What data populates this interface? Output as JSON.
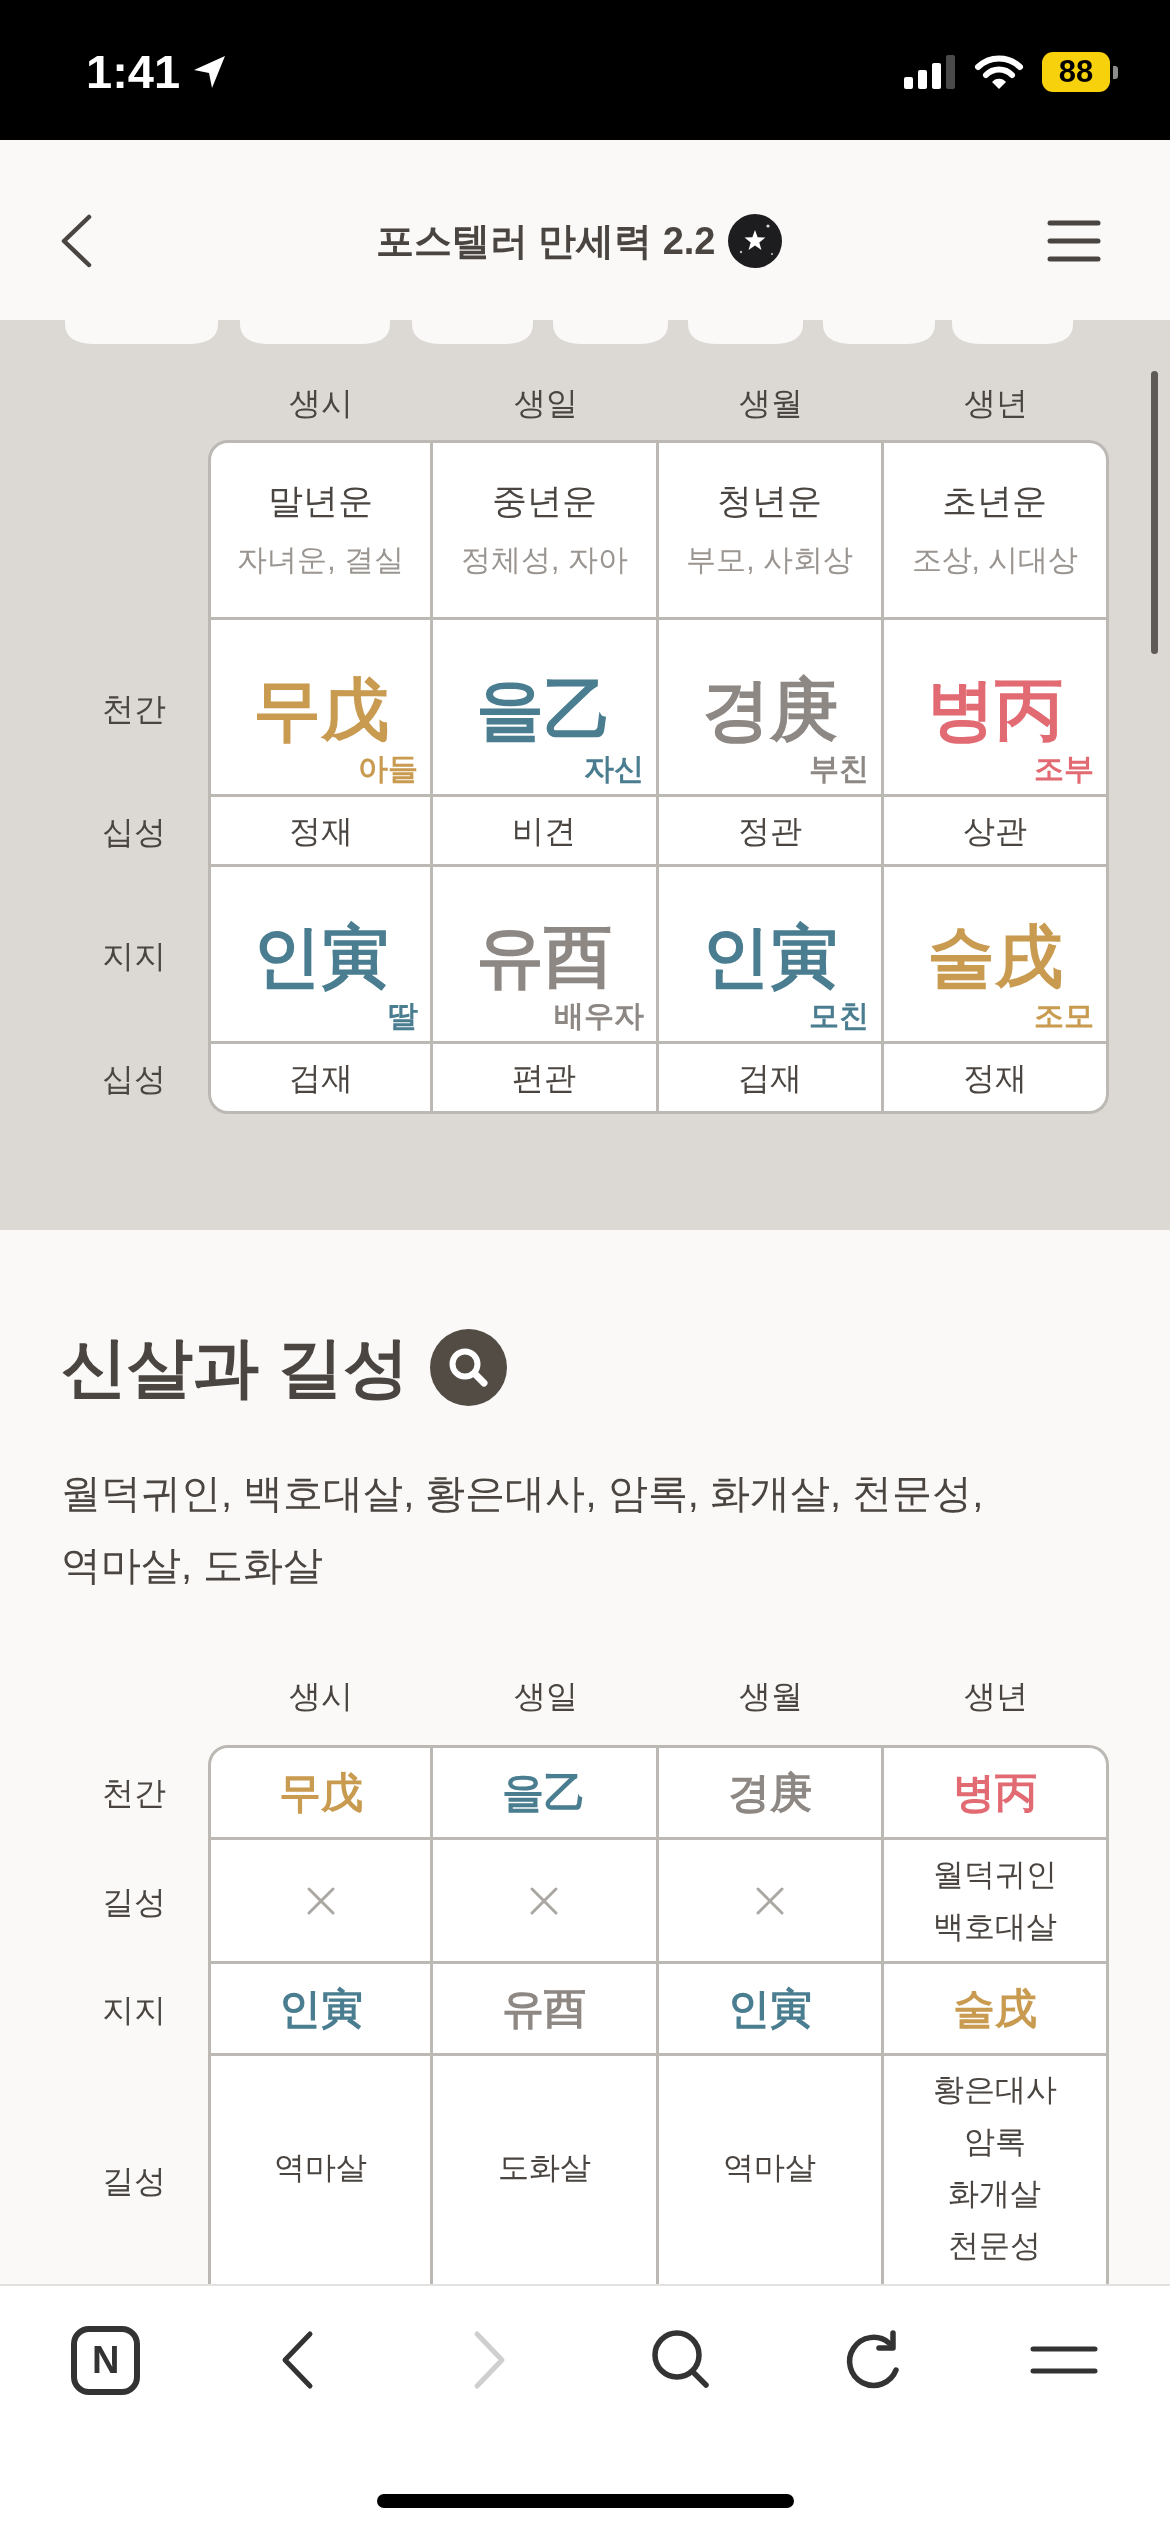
{
  "status_bar": {
    "time": "1:41",
    "battery": "88"
  },
  "header": {
    "title": "포스텔러 만세력 2.2"
  },
  "pillar_table": {
    "columns": [
      "생시",
      "생일",
      "생월",
      "생년"
    ],
    "rows": [
      {
        "kind": "fortune",
        "cells": [
          {
            "title": "말년운",
            "subtitle": "자녀운, 결실"
          },
          {
            "title": "중년운",
            "subtitle": "정체성, 자아"
          },
          {
            "title": "청년운",
            "subtitle": "부모, 사회상"
          },
          {
            "title": "초년운",
            "subtitle": "조상, 시대상"
          }
        ]
      },
      {
        "kind": "stem",
        "label": "천간",
        "cells": [
          {
            "text": "무戊",
            "relation": "아들",
            "color": "#c99b51"
          },
          {
            "text": "을乙",
            "relation": "자신",
            "color": "#4b7d90"
          },
          {
            "text": "경庚",
            "relation": "부친",
            "color": "#8e8884"
          },
          {
            "text": "병丙",
            "relation": "조부",
            "color": "#e26b73"
          }
        ]
      },
      {
        "kind": "plain",
        "label": "십성",
        "cells": [
          {
            "text": "정재"
          },
          {
            "text": "비견"
          },
          {
            "text": "정관"
          },
          {
            "text": "상관"
          }
        ]
      },
      {
        "kind": "stem",
        "label": "지지",
        "cells": [
          {
            "text": "인寅",
            "relation": "딸",
            "color": "#4b7d90"
          },
          {
            "text": "유酉",
            "relation": "배우자",
            "color": "#8e8884"
          },
          {
            "text": "인寅",
            "relation": "모친",
            "color": "#4b7d90"
          },
          {
            "text": "술戌",
            "relation": "조모",
            "color": "#c99b51"
          }
        ]
      },
      {
        "kind": "plain",
        "label": "십성",
        "cells": [
          {
            "text": "겁재"
          },
          {
            "text": "편관"
          },
          {
            "text": "겁재"
          },
          {
            "text": "정재"
          }
        ]
      }
    ]
  },
  "sinsal_section": {
    "title": "신살과 길성",
    "summary": "월덕귀인, 백호대살, 황은대사, 암록, 화개살, 천문성, 역마살, 도화살",
    "table": {
      "columns": [
        "생시",
        "생일",
        "생월",
        "생년"
      ],
      "rows": [
        {
          "kind": "pillar",
          "label": "천간",
          "cells": [
            {
              "text": "무戊",
              "color": "#c99b51"
            },
            {
              "text": "을乙",
              "color": "#4b7d90"
            },
            {
              "text": "경庚",
              "color": "#8e8884"
            },
            {
              "text": "병丙",
              "color": "#e26b73"
            }
          ]
        },
        {
          "kind": "stars",
          "label": "길성",
          "cells": [
            {
              "kind": "none"
            },
            {
              "kind": "none"
            },
            {
              "kind": "none"
            },
            {
              "kind": "list",
              "items": [
                "월덕귀인",
                "백호대살"
              ]
            }
          ]
        },
        {
          "kind": "pillar",
          "label": "지지",
          "cells": [
            {
              "text": "인寅",
              "color": "#4b7d90"
            },
            {
              "text": "유酉",
              "color": "#8e8884"
            },
            {
              "text": "인寅",
              "color": "#4b7d90"
            },
            {
              "text": "술戌",
              "color": "#c99b51"
            }
          ]
        },
        {
          "kind": "stars",
          "label": "길성",
          "cells": [
            {
              "kind": "list",
              "items": [
                "역마살"
              ]
            },
            {
              "kind": "list",
              "items": [
                "도화살"
              ]
            },
            {
              "kind": "list",
              "items": [
                "역마살"
              ]
            },
            {
              "kind": "list",
              "items": [
                "황은대사",
                "암록",
                "화개살",
                "천문성"
              ]
            }
          ]
        }
      ]
    }
  },
  "bottom_nav": [
    {
      "kind": "logo",
      "label": "N",
      "disabled": false
    },
    {
      "kind": "back",
      "disabled": false
    },
    {
      "kind": "forward",
      "disabled": true
    },
    {
      "kind": "search",
      "disabled": false
    },
    {
      "kind": "reload",
      "disabled": false
    },
    {
      "kind": "menu",
      "disabled": false
    }
  ]
}
